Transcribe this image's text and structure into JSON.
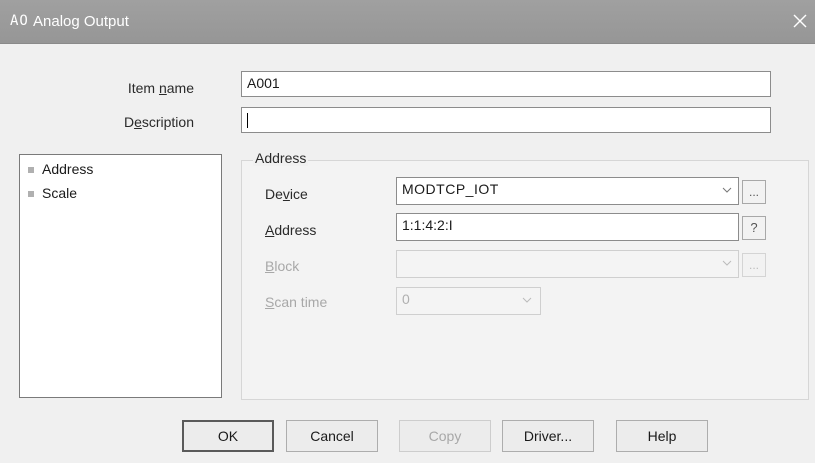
{
  "window": {
    "icon_text": "AO",
    "title": "Analog Output"
  },
  "form": {
    "item_name_label": {
      "pre": "Item ",
      "key": "n",
      "post": "ame"
    },
    "item_name_value": "A001",
    "description_label": {
      "pre": "D",
      "key": "e",
      "post": "scription"
    },
    "description_value": ""
  },
  "tree": {
    "items": [
      {
        "label": "Address"
      },
      {
        "label": "Scale"
      }
    ]
  },
  "address_group": {
    "legend": "Address",
    "device_label": {
      "pre": "De",
      "key": "v",
      "post": "ice"
    },
    "device_value": "MODTCP_IOT",
    "address_label": {
      "pre": "",
      "key": "A",
      "post": "ddress"
    },
    "address_value": "1:1:4:2:I",
    "address_help": "?",
    "block_label": {
      "pre": "",
      "key": "B",
      "post": "lock"
    },
    "block_value": "",
    "scan_label": {
      "pre": "",
      "key": "S",
      "post": "can time"
    },
    "scan_value": "0",
    "browse_label": "..."
  },
  "buttons": {
    "ok": "OK",
    "cancel": "Cancel",
    "copy": "Copy",
    "driver": "Driver...",
    "help": "Help"
  },
  "colors": {
    "titlebar": "#9c9c9c",
    "dialog_bg": "#f0f0f0",
    "disabled_text": "#a8a8a8"
  }
}
